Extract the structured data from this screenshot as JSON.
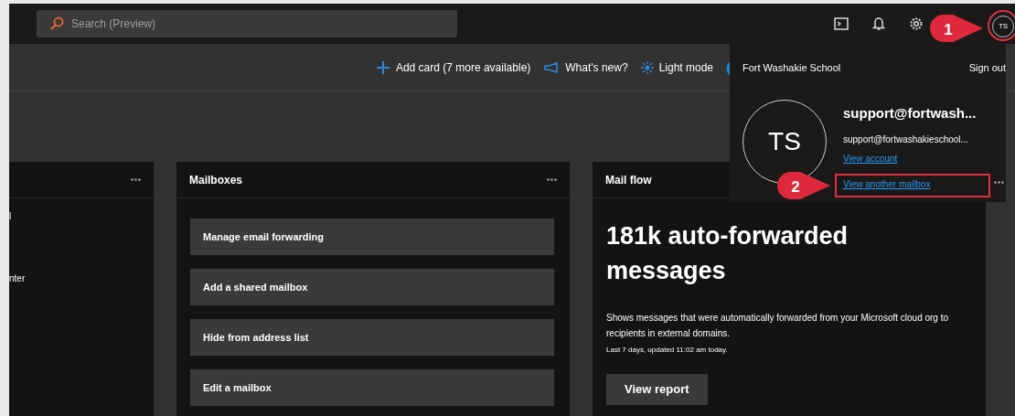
{
  "search": {
    "placeholder": "Search (Preview)"
  },
  "header": {
    "avatar_initials": "TS"
  },
  "command_bar": [
    {
      "kind": "add",
      "label": "Add card (7 more available)"
    },
    {
      "kind": "news",
      "label": "What's new?"
    },
    {
      "kind": "theme",
      "label": "Light mode"
    }
  ],
  "cards": [
    {
      "kind": "partial",
      "lines": [
        "l",
        "nter"
      ]
    },
    {
      "kind": "actions",
      "title": "Mailboxes",
      "actions": [
        "Manage email forwarding",
        "Add a shared mailbox",
        "Hide from address list",
        "Edit a mailbox"
      ]
    },
    {
      "kind": "stat",
      "title": "Mail flow",
      "headline": "181k auto-forwarded messages",
      "description": "Shows messages that were automatically forwarded from your Microsoft cloud org to recipients in external domains.",
      "updated": "Last 7 days, updated 11:02 am today.",
      "button": "View report"
    }
  ],
  "account_menu": {
    "organization": "Fort Washakie School",
    "sign_out": "Sign out",
    "initials": "TS",
    "name": "support@fortwash...",
    "email": "support@fortwashakieschool...",
    "links": [
      "View account",
      "View another mailbox"
    ]
  },
  "callouts": [
    {
      "number": "1"
    },
    {
      "number": "2"
    }
  ]
}
